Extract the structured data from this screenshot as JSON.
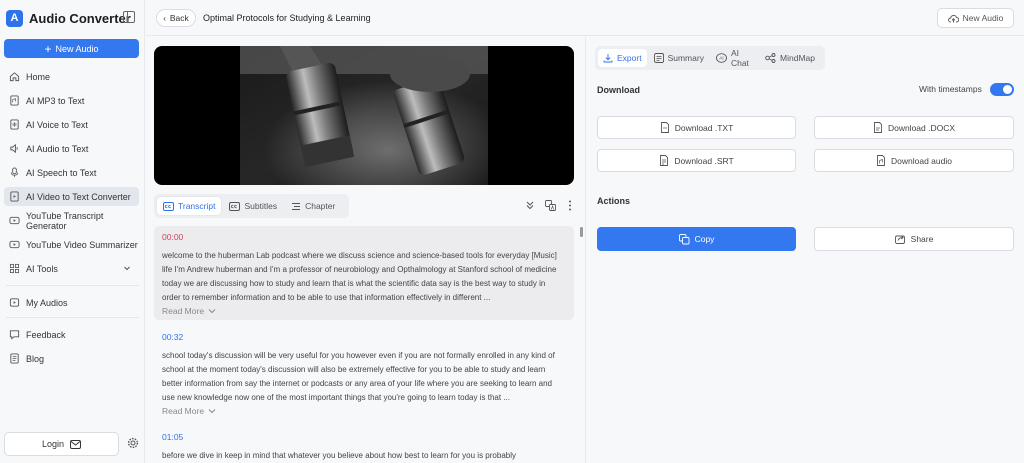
{
  "app": {
    "name": "Audio Converter",
    "logo_letter": "A"
  },
  "sidebar": {
    "new_audio_label": "New Audio",
    "items": [
      {
        "label": "Home",
        "icon": "home-icon"
      },
      {
        "label": "AI MP3 to Text",
        "icon": "file-audio-icon"
      },
      {
        "label": "AI Voice to Text",
        "icon": "file-audio-icon"
      },
      {
        "label": "AI Audio to Text",
        "icon": "speaker-icon"
      },
      {
        "label": "AI Speech to Text",
        "icon": "mic-icon"
      },
      {
        "label": "AI Video to Text Converter",
        "icon": "video-icon",
        "active": true
      },
      {
        "label": "YouTube Transcript Generator",
        "icon": "youtube-icon"
      },
      {
        "label": "YouTube Video Summarizer",
        "icon": "youtube-icon"
      },
      {
        "label": "AI Tools",
        "icon": "grid-icon"
      },
      {
        "label": "My Audios",
        "icon": "folder-play-icon"
      },
      {
        "label": "Feedback",
        "icon": "chat-icon"
      },
      {
        "label": "Blog",
        "icon": "document-icon"
      }
    ],
    "login_label": "Login"
  },
  "header": {
    "back_label": "Back",
    "title": "Optimal Protocols for Studying & Learning",
    "new_audio_label": "New Audio"
  },
  "player": {
    "tabs": [
      {
        "label": "Transcript",
        "active": true
      },
      {
        "label": "Subtitles"
      },
      {
        "label": "Chapter"
      }
    ]
  },
  "transcript": {
    "read_more": "Read More",
    "segments": [
      {
        "time": "00:00",
        "text": "welcome to the huberman Lab podcast where we discuss science and science-based tools for everyday [Music] life I'm Andrew huberman and I'm a professor of neurobiology and Opthalmology at Stanford school of medicine today we are discussing how to study and learn that is what the scientific data say is the best way to study in order to remember information and to be able to use that information effectively in different ..."
      },
      {
        "time": "00:32",
        "text": "school today's discussion will be very useful for you however even if you are not formally enrolled in any kind of school at the moment today's discussion will also be extremely effective for you to be able to study and learn better information from say the internet or podcasts or any area of your life where you are seeking to learn and use new knowledge now one of the most important things that you're going to learn today is that ..."
      },
      {
        "time": "01:05",
        "text": "before we dive in keep in mind that whatever you believe about how best to learn for you is probably"
      }
    ]
  },
  "export_panel": {
    "tabs": [
      {
        "label": "Export",
        "active": true
      },
      {
        "label": "Summary"
      },
      {
        "label": "AI Chat"
      },
      {
        "label": "MindMap"
      }
    ],
    "download_title": "Download",
    "timestamps_label": "With timestamps",
    "timestamps_on": true,
    "downloads": {
      "txt": "Download .TXT",
      "docx": "Download .DOCX",
      "srt": "Download .SRT",
      "audio": "Download audio"
    },
    "actions_title": "Actions",
    "copy_label": "Copy",
    "share_label": "Share"
  },
  "colors": {
    "accent": "#3478f0",
    "first_time": "#d0425c",
    "time": "#2f73e9"
  }
}
